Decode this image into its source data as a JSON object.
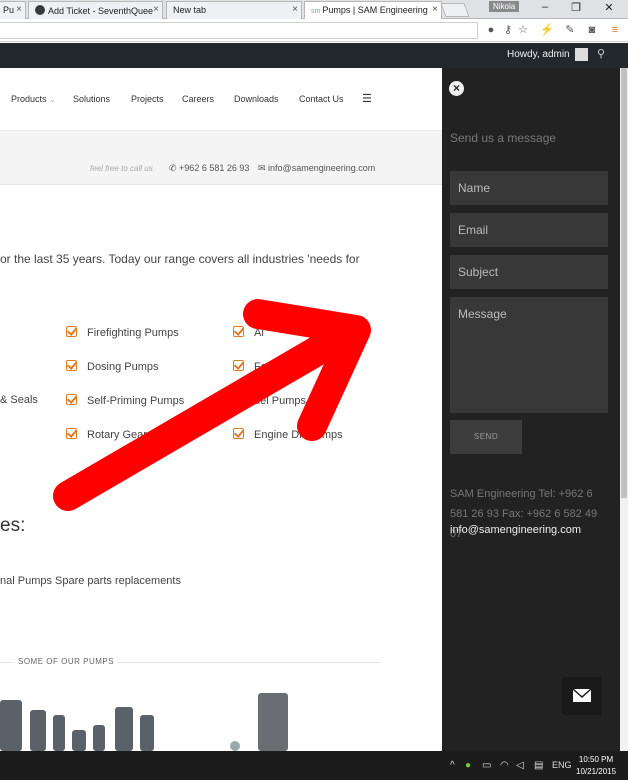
{
  "browser": {
    "tabs": [
      {
        "label": "Pu",
        "active": false
      },
      {
        "label": "Add Ticket - SeventhQuee",
        "active": false
      },
      {
        "label": "New tab",
        "active": false
      },
      {
        "label": "Pumps | SAM Engineering",
        "active": true
      }
    ],
    "profile_name": "Nikola"
  },
  "adminbar": {
    "howdy": "Howdy, admin"
  },
  "nav": {
    "items": [
      "Products",
      "Solutions",
      "Projects",
      "Careers",
      "Downloads",
      "Contact Us"
    ]
  },
  "contact": {
    "call_text": "feel free to call us",
    "phone": "+962 6 581 26 93",
    "email": "info@samengineering.com"
  },
  "content": {
    "intro": "or the last 35 years. Today our range covers all industries 'needs for",
    "pumps_col1": [
      "& Seals"
    ],
    "pumps_col2": [
      "Firefighting Pumps",
      "Dosing Pumps",
      "Self-Priming Pumps",
      "Rotary Gear P"
    ],
    "pumps_col3": [
      "Ai",
      "Fo",
      "uel Pumps",
      "Engine Dri    Pumps"
    ],
    "heading": "es:",
    "spare_text": "nal Pumps Spare parts replacements",
    "section_label": "SOME OF OUR PUMPS"
  },
  "panel": {
    "title": "Send us a message",
    "name_placeholder": "Name",
    "email_placeholder": "Email",
    "subject_placeholder": "Subject",
    "message_placeholder": "Message",
    "send_label": "SEND",
    "info": "SAM Engineering Tel: +962 6 581 26 93 Fax: +962 6 582 49 07",
    "email": "info@samengineering.com"
  },
  "taskbar": {
    "lang": "ENG",
    "time": "10:50 PM",
    "date": "10/21/2015"
  },
  "colors": {
    "accent_orange": "#e07b1f",
    "panel_bg": "#222222",
    "arrow_red": "#ff0000"
  }
}
